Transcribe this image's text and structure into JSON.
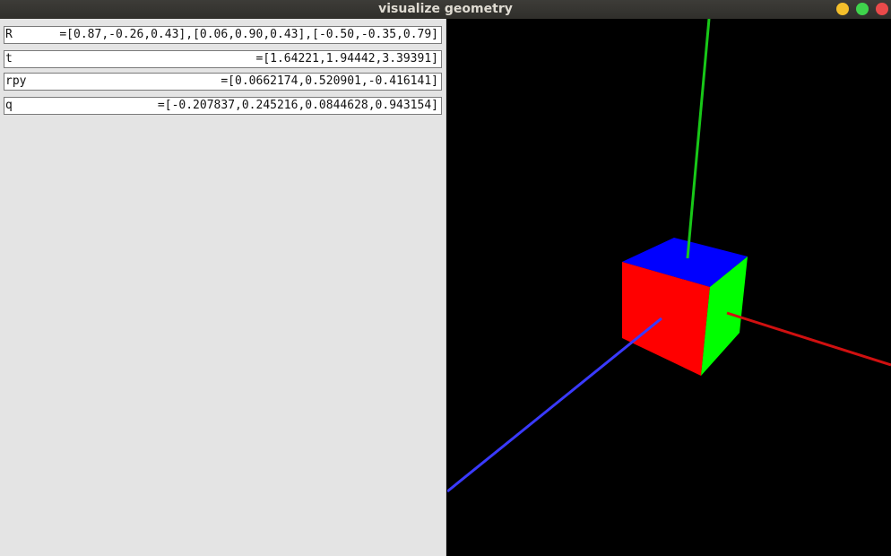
{
  "window": {
    "title": "visualize geometry"
  },
  "panel": {
    "fields": [
      {
        "label": "R",
        "value": "=[0.87,-0.26,0.43],[0.06,0.90,0.43],[-0.50,-0.35,0.79]"
      },
      {
        "label": "t",
        "value": "=[1.64221,1.94442,3.39391]"
      },
      {
        "label": "rpy",
        "value": "=[0.0662174,0.520901,-0.416141]"
      },
      {
        "label": "q",
        "value": "=[-0.207837,0.245216,0.0844628,0.943154]"
      }
    ]
  },
  "scene": {
    "background": "#000000",
    "axis_colors": {
      "x": "#d01010",
      "y": "#18c818",
      "z": "#3a3aff"
    },
    "cube_face_colors": {
      "front": "#ff0000",
      "top": "#0000ff",
      "side": "#00ff00"
    }
  }
}
